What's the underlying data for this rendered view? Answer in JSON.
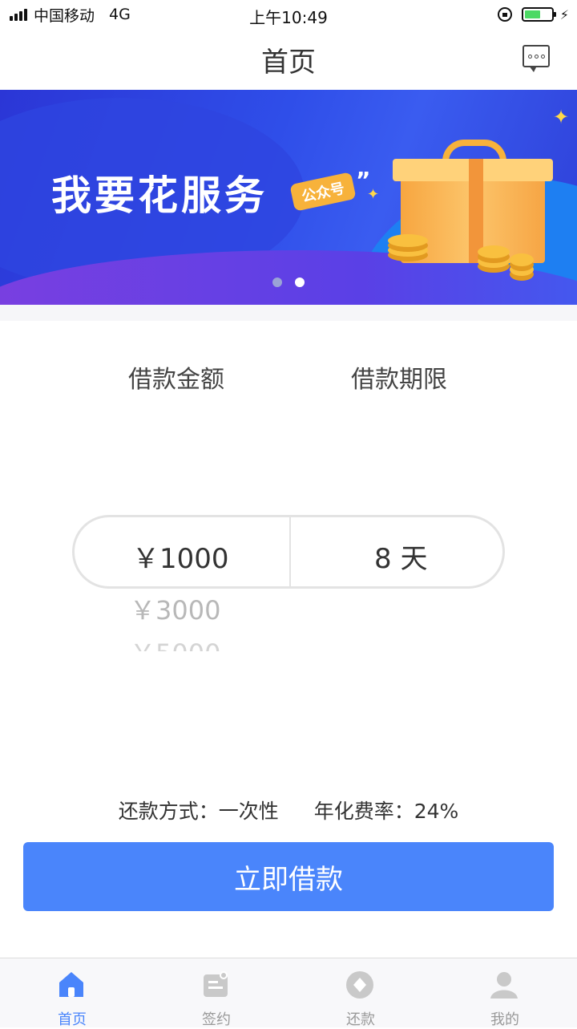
{
  "status_bar": {
    "carrier": "中国移动",
    "network": "4G",
    "time": "上午10:49"
  },
  "nav": {
    "title": "首页",
    "message_icon": "message-icon"
  },
  "banner": {
    "text": "我要花服务",
    "tag": "公众号",
    "quote": "”",
    "page_count": 2,
    "active_page": 2
  },
  "loan": {
    "amount_label": "借款金额",
    "term_label": "借款期限",
    "amount_selected": "￥1000",
    "amount_options_below": [
      "￥3000",
      "￥5000"
    ],
    "term_selected": "8 天"
  },
  "info": {
    "repay_method": "还款方式：一次性",
    "annual_rate": "年化费率：24%"
  },
  "cta": {
    "label": "立即借款"
  },
  "tabbar": {
    "items": [
      {
        "label": "首页",
        "icon": "home-icon",
        "active": true
      },
      {
        "label": "签约",
        "icon": "contract-icon",
        "active": false
      },
      {
        "label": "还款",
        "icon": "repay-icon",
        "active": false
      },
      {
        "label": "我的",
        "icon": "profile-icon",
        "active": false
      }
    ]
  },
  "colors": {
    "accent": "#4a85fb",
    "tab_inactive": "#999999",
    "banner_blue": "#2f4ee9"
  }
}
